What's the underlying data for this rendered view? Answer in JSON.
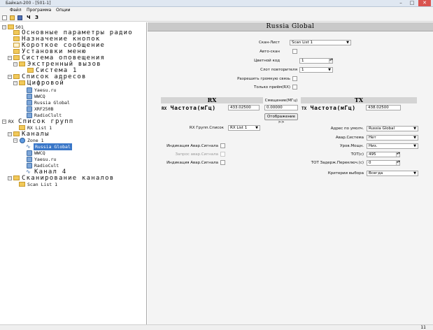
{
  "window": {
    "title": "Байкал-200 - [501-1]",
    "buttons": {
      "minimize": "–",
      "maximize": "□",
      "close": "✕"
    }
  },
  "menu": {
    "items": [
      "Файл",
      "Программа",
      "Опции"
    ]
  },
  "toolbar": {
    "items": [
      "new",
      "open",
      "save",
      "Ч",
      "З"
    ]
  },
  "tree": {
    "root": "501",
    "nodes": [
      "Основные параметры радио",
      "Назначение кнопок",
      "Короткое сообщение",
      "Установки меню",
      "Система оповещения",
      "Экстренный вызов",
      "Система 1",
      "Список адресов",
      "Цифровой",
      "Yaesu.ru",
      "WWCQ",
      "Russia Global",
      "XRF250B",
      "RadioClult",
      "Список групп",
      "RX List 1",
      "Каналы",
      "Zone 1",
      "Russia Global",
      "WWCQ",
      "Yaesu.ru",
      "RadioCult",
      "Канал 4",
      "Сканирование каналов",
      "Scan List 1"
    ],
    "rx_prefix": "RX"
  },
  "panel": {
    "title": "Russia Global",
    "top": {
      "scan_list_label": "Скан-Лист",
      "scan_list_value": "Scan List 1",
      "auto_scan_label": "Авто-скан",
      "color_code_label": "Цветной код",
      "color_code_value": "1",
      "repeater_slot_label": "Слот повторителя",
      "repeater_slot_value": "1",
      "loud_call_label": "Разрешить громкую связь",
      "rx_only_label": "Только приём(RX)"
    },
    "rx": {
      "header": "RX",
      "prefix": "RX",
      "freq_label": "Частота(мГц)",
      "freq_value": "433.02500"
    },
    "offset": {
      "label": "Смещение(МГц)",
      "value": "0.00000",
      "button": "Отображение >>"
    },
    "tx": {
      "header": "TX",
      "prefix": "TX",
      "freq_label": "Частота(мГц)",
      "freq_value": "438.02500"
    },
    "left": {
      "rx_group_label": "RX Групп.Список",
      "rx_group_value": "RX List 1",
      "alarm_ind_label": "Индикация Авар.Сигнала",
      "alarm_req_label": "Запрос авар.Сигнала",
      "alarm_ind2_label": "Индикация Авар.Сигнала"
    },
    "right": {
      "default_addr_label": "Адрес по умолч.",
      "default_addr_value": "Russia Global",
      "alarm_sys_label": "Авар.Система",
      "alarm_sys_value": "Нет",
      "power_label": "Уров.Мощн.",
      "power_value": "Низ.",
      "tot_label": "TOT(c)",
      "tot_value": "495",
      "tot_delay_label": "TOT Задерж.Переключ.(c)",
      "tot_delay_value": "0",
      "criteria_label": "Критерии выбора",
      "criteria_value": "Всегда"
    }
  },
  "status": {
    "right_number": "11"
  },
  "colors": {
    "selection": "#3a77c8",
    "header_bg": "#c9c9c9",
    "folder": "#f1c95a"
  }
}
